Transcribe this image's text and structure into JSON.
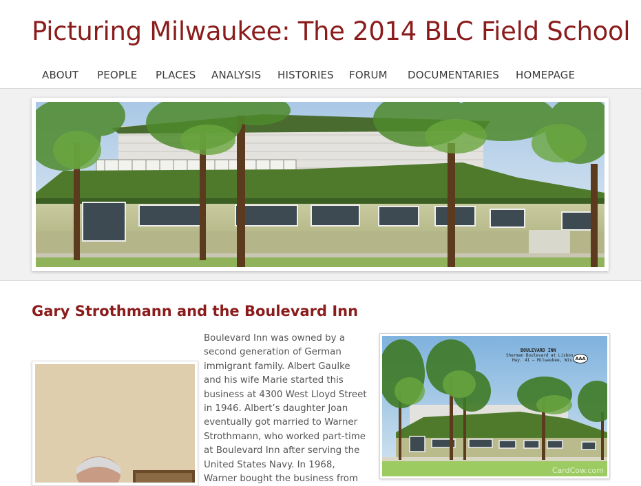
{
  "site": {
    "title": "Picturing Milwaukee: The 2014 BLC Field School"
  },
  "nav": {
    "items": [
      "ABOUT",
      "PEOPLE",
      "PLACES",
      "ANALYSIS",
      "HISTORIES",
      "FORUM",
      "DOCUMENTARIES",
      "HOMEPAGE"
    ]
  },
  "article": {
    "title": "Gary Strothmann and the Boulevard Inn",
    "paragraph_lines": [
      "Boulevard Inn was owned by a",
      "second generation of German",
      "immigrant family. Albert Gaulke",
      "and his wife Marie started this",
      "business at 4300 West Lloyd Street",
      "in 1946.  Albert’s daughter Joan",
      "eventually got married to Warner",
      "Strothmann, who worked part-time",
      "at Boulevard Inn after serving the",
      "United States Navy.  In 1968,",
      "Warner bought the business from"
    ]
  },
  "postcard": {
    "line1": "BOULEVARD INN",
    "line2": "Sherman Boulevard at Lisbon",
    "line3": "Hwy. 41 – Milwaukee, Wis.",
    "badge": "AAA",
    "watermark": "CardCow.com"
  },
  "colors": {
    "title_red": "#8b1c1c",
    "nav_text": "#3a3a3a",
    "body_text": "#555555"
  }
}
